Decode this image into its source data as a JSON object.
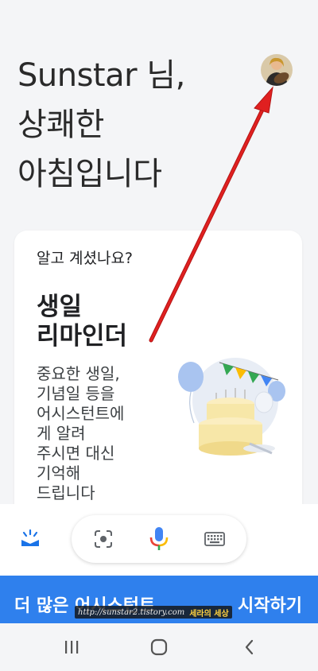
{
  "greeting": {
    "line1": "Sunstar 님,",
    "line2": "상쾌한",
    "line3": "아침입니다"
  },
  "card": {
    "eyebrow": "알고 계셨나요?",
    "title_line1": "생일",
    "title_line2": "리마인더",
    "body_lines": [
      "중요한 생일,",
      "기념일 등을",
      "어시스턴트에",
      "게 알려",
      "주시면 대신",
      "기억해",
      "드립니다"
    ]
  },
  "banner": {
    "left_text": "더 많은 어시스턴트",
    "right_text": "시작하기"
  },
  "watermark": {
    "url": "http://sunstar2.tistory.com",
    "brand": "세라의 세상"
  },
  "icons": {
    "snapshot": "snapshot-icon",
    "lens": "lens-icon",
    "mic": "mic-icon",
    "keyboard": "keyboard-icon",
    "recents": "recents-icon",
    "home": "home-icon",
    "back": "back-icon"
  },
  "colors": {
    "accent_blue": "#2f80ed",
    "annotation_red": "#e02020",
    "google_blue": "#4285f4",
    "google_red": "#ea4335",
    "google_yellow": "#fbbc04",
    "google_green": "#34a853"
  }
}
